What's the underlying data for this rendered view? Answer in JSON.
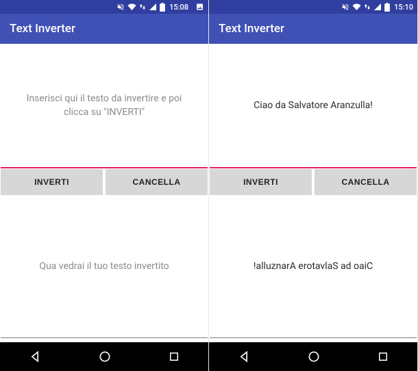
{
  "app_title": "Text Inverter",
  "buttons": {
    "invert": "INVERTI",
    "clear": "CANCELLA"
  },
  "left": {
    "statusbar": {
      "time": "15:08"
    },
    "input_placeholder": "Inserisci qui il testo da invertire e poi clicca su \"INVERTI\"",
    "input_value": "",
    "output_placeholder": "Qua vedrai il tuo testo invertito",
    "output_value": ""
  },
  "right": {
    "statusbar": {
      "time": "15:10"
    },
    "input_placeholder": "Inserisci qui il testo da invertire e poi clicca su \"INVERTI\"",
    "input_value": "Ciao da Salvatore Aranzulla!",
    "output_placeholder": "Qua vedrai il tuo testo invertito",
    "output_value": "!alluznarA erotavlaS ad oaiC"
  },
  "colors": {
    "primary": "#3F51B5",
    "primary_dark": "#303F9F",
    "accent": "#E91E63"
  }
}
